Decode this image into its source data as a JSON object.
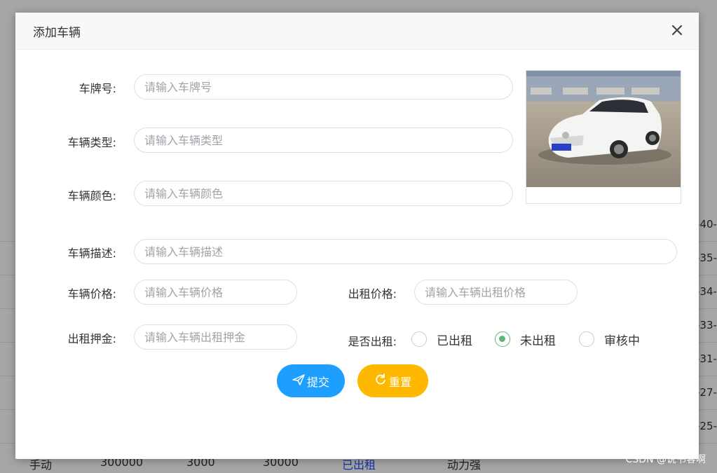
{
  "background": {
    "right_column": [
      "-40-",
      "-35-",
      "-34-",
      "-33-",
      "-31-",
      "-27-",
      "-25-"
    ],
    "bottom_row": [
      "手动",
      "300000",
      "3000",
      "30000",
      "已出租",
      "动力强"
    ]
  },
  "dialog": {
    "title": "添加车辆",
    "close_icon": "close-icon"
  },
  "form": {
    "plate": {
      "label": "车牌号:",
      "placeholder": "请输入车牌号"
    },
    "type": {
      "label": "车辆类型:",
      "placeholder": "请输入车辆类型"
    },
    "color": {
      "label": "车辆颜色:",
      "placeholder": "请输入车辆颜色"
    },
    "desc": {
      "label": "车辆描述:",
      "placeholder": "请输入车辆描述"
    },
    "price": {
      "label": "车辆价格:",
      "placeholder": "请输入车辆价格"
    },
    "rent_price": {
      "label": "出租价格:",
      "placeholder": "请输入车辆出租价格"
    },
    "deposit": {
      "label": "出租押金:",
      "placeholder": "请输入车辆出租押金"
    },
    "rented": {
      "label": "是否出租:",
      "options": [
        "已出租",
        "未出租",
        "审核中"
      ],
      "selected": "未出租"
    }
  },
  "buttons": {
    "submit": "提交",
    "reset": "重置"
  },
  "watermark": "CSDN @说书客啊"
}
